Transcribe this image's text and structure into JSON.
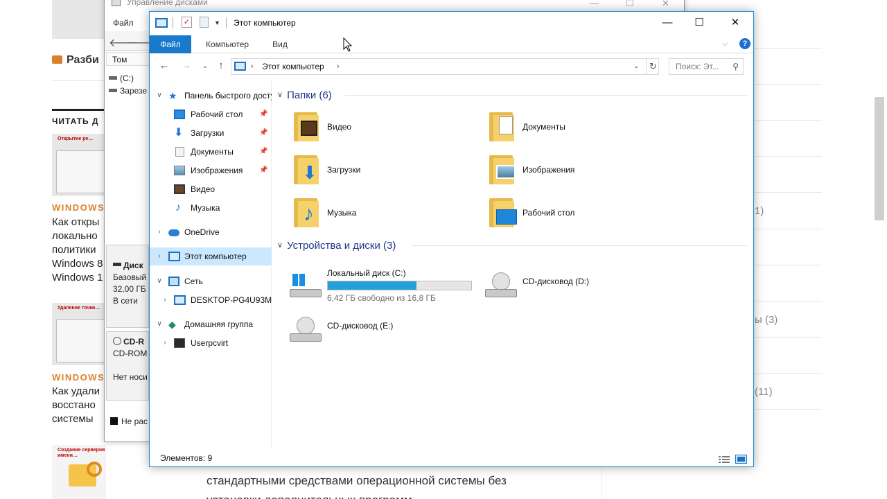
{
  "background_page": {
    "gallery_label": "Разби",
    "read_label": "ЧИТАТЬ Д",
    "thumb1_caption": "Открытие ре…",
    "thumb2_caption": "Удаление точки…",
    "thumb3_caption": "Создание серверов имени…",
    "article1_category": "WINDOWS",
    "article1_title_lines": [
      "Как откры",
      "локально",
      "политики",
      "Windows 8",
      "Windows 1"
    ],
    "article2_category": "WINDOWS",
    "article2_title_lines": [
      "Как удали",
      "восстано",
      "системы"
    ],
    "bottom_text_lines": [
      "стандартными средствами операционной системы без",
      "установки дополнительных программ"
    ],
    "right_counts": [
      "1)",
      "ы (3)",
      "(11)"
    ]
  },
  "disk_management": {
    "title": "Управление дисками",
    "menu_file": "Файл",
    "column_volume": "Том",
    "volumes": [
      "(C:)",
      "Зарезе"
    ],
    "disk0_title": "Диск",
    "disk0_lines": [
      "Базовый",
      "32,00 ГБ",
      "В сети"
    ],
    "disk1_title": "CD-R",
    "disk1_lines": [
      "CD-ROM",
      "",
      "Нет носи"
    ],
    "legend_label": "Не рас"
  },
  "explorer": {
    "title": "Этот компьютер",
    "window_controls": {
      "minimize": "—",
      "maximize": "☐",
      "close": "✕"
    },
    "ribbon_tabs": [
      "Файл",
      "Компьютер",
      "Вид"
    ],
    "help": "?",
    "address": {
      "path_item": "Этот компьютер"
    },
    "search": {
      "placeholder": "Поиск: Эт..."
    },
    "nav": {
      "quick_access": "Панель быстрого доступа",
      "pinned": [
        "Рабочий стол",
        "Загрузки",
        "Документы",
        "Изображения"
      ],
      "unpinned": [
        "Видео",
        "Музыка"
      ],
      "onedrive": "OneDrive",
      "this_pc": "Этот компьютер",
      "network": "Сеть",
      "network_pc": "DESKTOP-PG4U93M",
      "homegroup": "Домашняя группа",
      "homegroup_user": "Userpcvirt"
    },
    "folders_header": "Папки (6)",
    "folders": [
      "Видео",
      "Документы",
      "Загрузки",
      "Изображения",
      "Музыка",
      "Рабочий стол"
    ],
    "devices_header": "Устройства и диски (3)",
    "drives": {
      "c": {
        "name": "Локальный диск (C:)",
        "free_text": "6,42 ГБ свободно из 16,8 ГБ",
        "used_fraction": 0.618,
        "bar_color": "#26a0da"
      },
      "d": {
        "name": "CD-дисковод (D:)"
      },
      "e": {
        "name": "CD-дисковод (E:)"
      }
    },
    "status": "Элементов: 9",
    "accent_color": "#1979ca"
  }
}
